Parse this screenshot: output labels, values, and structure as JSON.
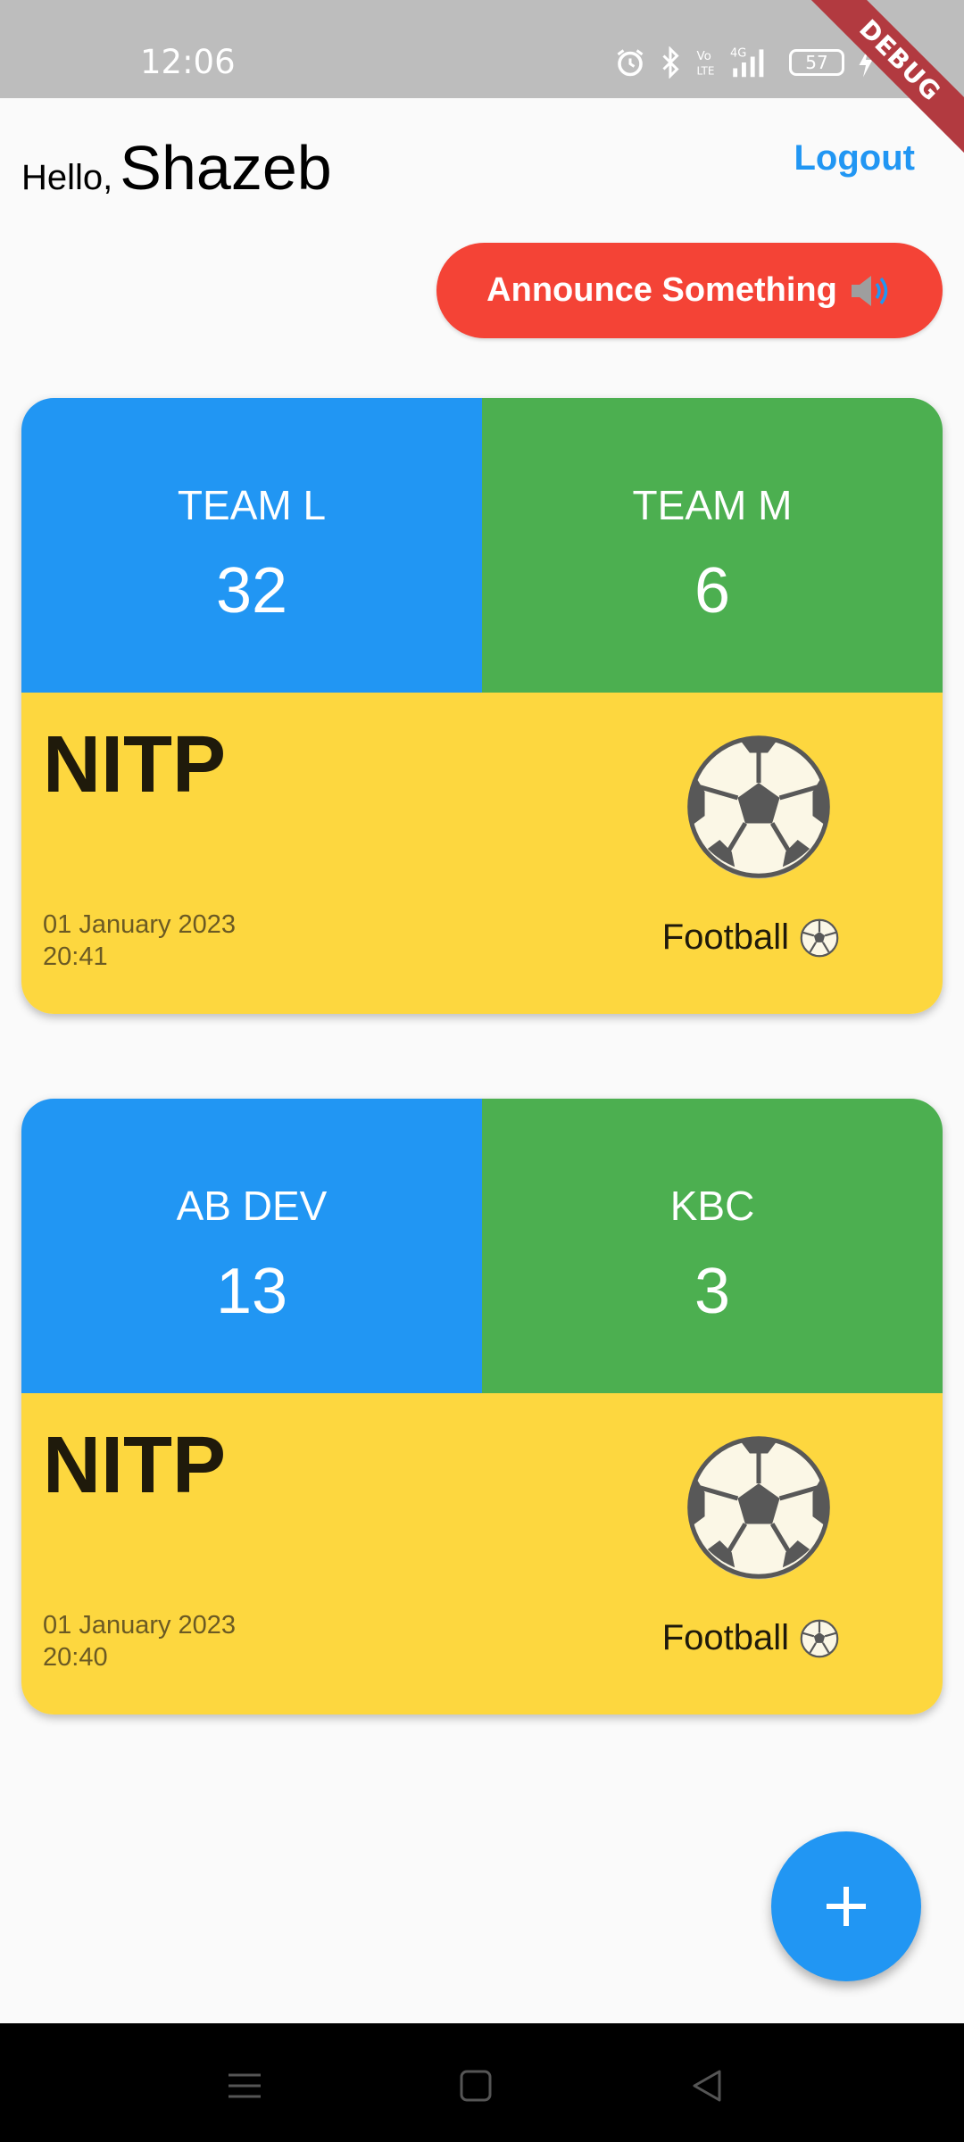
{
  "status_bar": {
    "time": "12:06",
    "battery": "57",
    "icons": [
      "alarm-icon",
      "bluetooth-icon",
      "volte-icon",
      "signal-4g-icon",
      "battery-icon",
      "charging-icon"
    ],
    "debug_banner": "DEBUG"
  },
  "header": {
    "hello": "Hello,",
    "name": "Shazeb",
    "logout": "Logout"
  },
  "announce": {
    "label": "Announce Something",
    "icon": "speaker-icon"
  },
  "matches": [
    {
      "team_left": {
        "name": "TEAM L",
        "score": "32"
      },
      "team_right": {
        "name": "TEAM M",
        "score": "6"
      },
      "venue": "NITP",
      "date": "01 January 2023",
      "time": "20:41",
      "sport": "Football",
      "sport_icon": "soccer-ball-icon"
    },
    {
      "team_left": {
        "name": "AB DEV",
        "score": "13"
      },
      "team_right": {
        "name": "KBC",
        "score": "3"
      },
      "venue": "NITP",
      "date": "01 January 2023",
      "time": "20:40",
      "sport": "Football",
      "sport_icon": "soccer-ball-icon"
    }
  ],
  "fab": {
    "icon": "plus-icon"
  },
  "colors": {
    "team_left": "#2196f3",
    "team_right": "#4caf50",
    "card_bottom": "#fdd73f",
    "announce": "#f44336",
    "accent": "#2196f3"
  }
}
